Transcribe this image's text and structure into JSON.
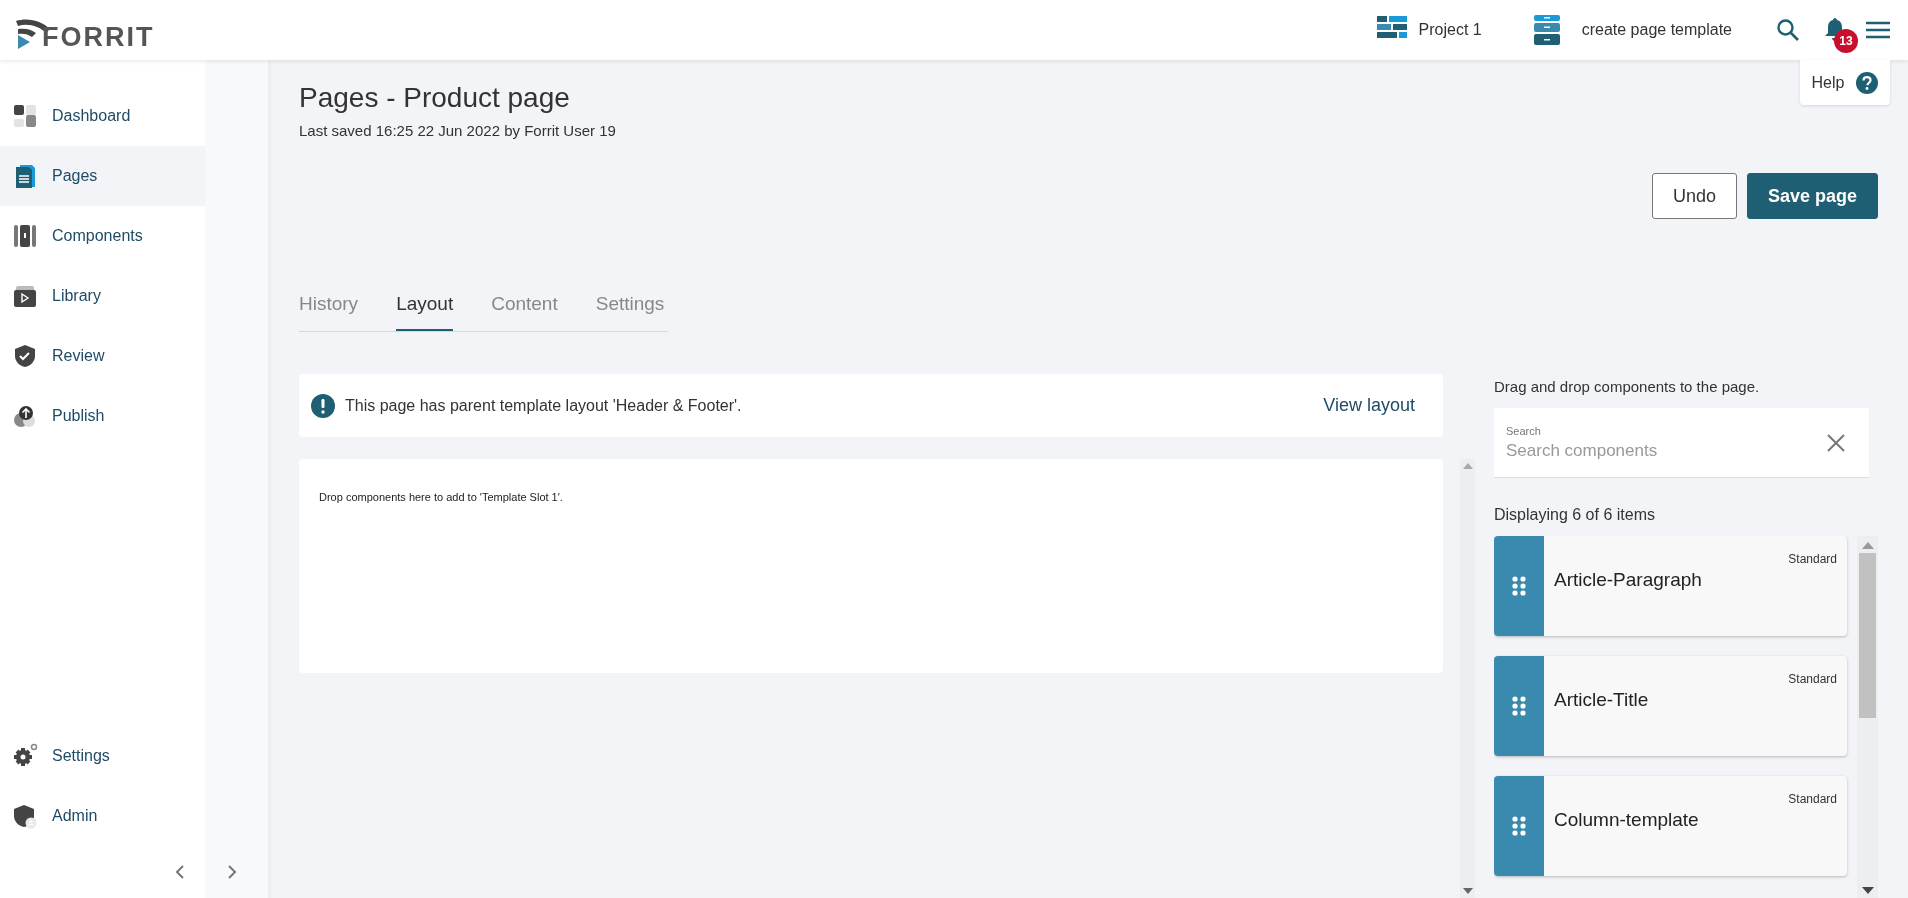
{
  "logo": {
    "text": "FORRIT"
  },
  "header": {
    "project": "Project 1",
    "template": "create page template",
    "notifications": "13",
    "help": "Help"
  },
  "sidebar": {
    "items": [
      {
        "label": "Dashboard",
        "selected": false
      },
      {
        "label": "Pages",
        "selected": true
      },
      {
        "label": "Components",
        "selected": false
      },
      {
        "label": "Library",
        "selected": false
      },
      {
        "label": "Review",
        "selected": false
      },
      {
        "label": "Publish",
        "selected": false
      }
    ],
    "footer_items": [
      {
        "label": "Settings",
        "selected": false
      },
      {
        "label": "Admin",
        "selected": false
      }
    ]
  },
  "page": {
    "title": "Pages - Product page",
    "subtitle": "Last saved 16:25 22 Jun 2022 by Forrit User 19"
  },
  "buttons": [
    {
      "label": "Undo",
      "kind": "secondary"
    },
    {
      "label": "Save page",
      "kind": "primary"
    }
  ],
  "tabs": [
    {
      "label": "History",
      "selected": false
    },
    {
      "label": "Layout",
      "selected": true
    },
    {
      "label": "Content",
      "selected": false
    },
    {
      "label": "Settings",
      "selected": false
    }
  ],
  "notice": {
    "text": "This page has parent template layout 'Header & Footer'.",
    "action": "View layout"
  },
  "drop_zone": {
    "text": "Drop components here to add to 'Template Slot 1'."
  },
  "palette": {
    "instruction": "Drag and drop components to the page.",
    "search": {
      "label": "Search",
      "placeholder": "Search components"
    },
    "count": "Displaying 6 of 6 items",
    "items": [
      {
        "name": "Article-Paragraph",
        "type": "Standard"
      },
      {
        "name": "Article-Title",
        "type": "Standard"
      },
      {
        "name": "Column-template",
        "type": "Standard"
      }
    ]
  }
}
